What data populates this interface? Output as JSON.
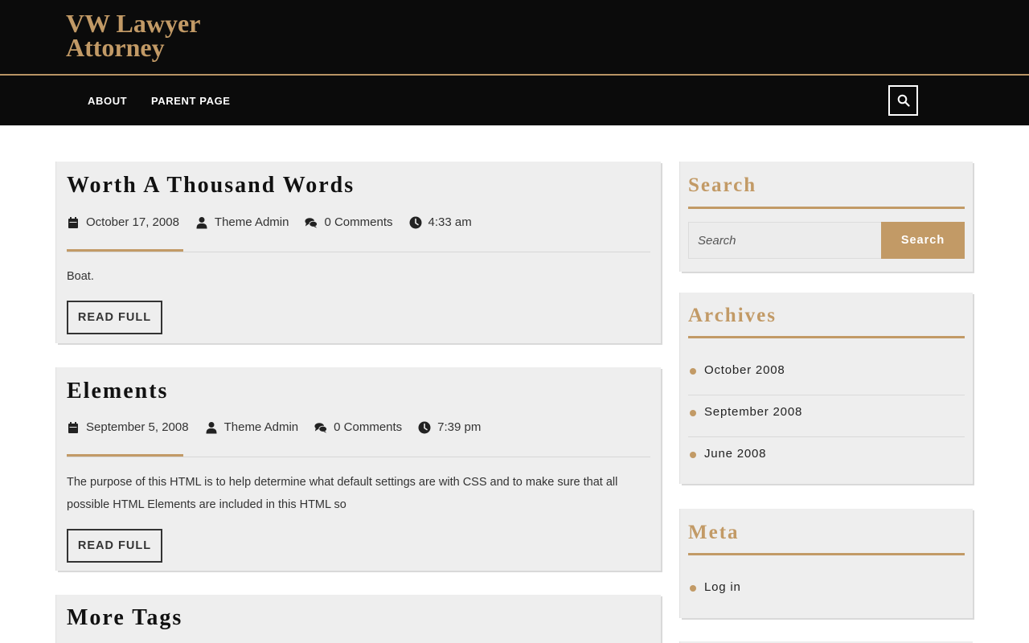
{
  "site": {
    "title": "VW Lawyer Attorney"
  },
  "nav": {
    "items": [
      {
        "label": "ABOUT"
      },
      {
        "label": "PARENT PAGE"
      }
    ]
  },
  "colors": {
    "accent": "#c29a66",
    "header_bg": "#0b0b0b",
    "card_bg": "#eeeeee"
  },
  "posts": [
    {
      "title": "Worth A Thousand Words",
      "date": "October 17, 2008",
      "author": "Theme Admin",
      "comments": "0 Comments",
      "time": "4:33 am",
      "excerpt": "Boat.",
      "read_label": "READ FULL"
    },
    {
      "title": "Elements",
      "date": "September 5, 2008",
      "author": "Theme Admin",
      "comments": "0 Comments",
      "time": "7:39 pm",
      "excerpt": "The purpose of this HTML is to help determine what default settings are with CSS and to make sure that all possible HTML Elements are included in this HTML so",
      "read_label": "READ FULL"
    },
    {
      "title": "More Tags"
    }
  ],
  "sidebar": {
    "search": {
      "title": "Search",
      "placeholder": "Search",
      "button_label": "Search"
    },
    "archives": {
      "title": "Archives",
      "items": [
        {
          "label": "October 2008"
        },
        {
          "label": "September 2008"
        },
        {
          "label": "June 2008"
        }
      ]
    },
    "meta": {
      "title": "Meta",
      "items": [
        {
          "label": "Log in"
        }
      ]
    }
  },
  "icons": {
    "header_search": "search-icon",
    "date": "calendar-icon",
    "author": "user-icon",
    "comments": "comments-icon",
    "time": "clock-icon",
    "bullet": "dot-icon"
  }
}
